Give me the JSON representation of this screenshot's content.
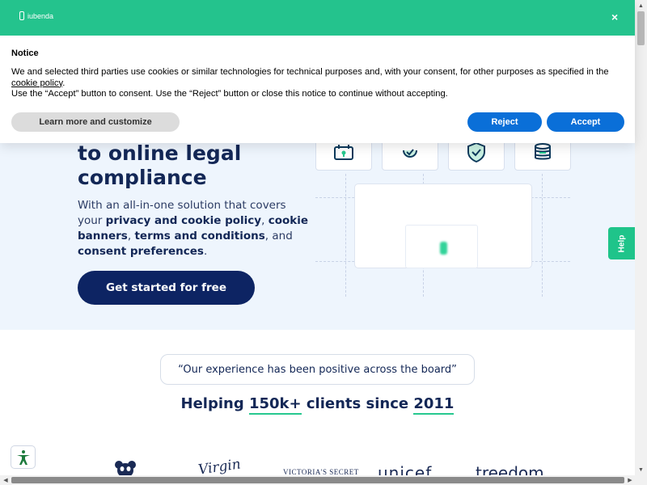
{
  "cookie_banner": {
    "brand": "iubenda",
    "close_glyph": "×",
    "title": "Notice",
    "text_before_link": "We and selected third parties use cookies or similar technologies for technical purposes and, with your consent, for other purposes as specified in the ",
    "link_text": "cookie policy",
    "text_after_link": ".",
    "text_line2": "Use the “Accept” button to consent. Use the “Reject” button or close this notice to continue without accepting.",
    "learn_more_label": "Learn more and customize",
    "reject_label": "Reject",
    "accept_label": "Accept",
    "header_color": "#24c38d",
    "button_color": "#0a6fd8"
  },
  "hero": {
    "heading_line1": "to online legal",
    "heading_line2": "compliance",
    "desc_1": "With an all-in-one solution that covers your ",
    "desc_b1": "privacy and cookie policy",
    "desc_2": ", ",
    "desc_b2": "cookie banners",
    "desc_3": ", ",
    "desc_b3": "terms and conditions",
    "desc_4": ", and ",
    "desc_b4": "consent preferences",
    "desc_5": ".",
    "cta_label": "Get started for free",
    "illustration_icons": [
      "lock-calendar-icon",
      "shield-check-icon",
      "shield-check-icon",
      "database-icon"
    ]
  },
  "help_tab": {
    "label": "Help"
  },
  "testimonial": {
    "quote": "“Our experience has been positive across the board”",
    "helping_prefix": "Helping ",
    "helping_count": "150k+",
    "helping_mid": " clients since ",
    "helping_year": "2011"
  },
  "logos": {
    "names": [
      "wwf-logo",
      "virgin-logo",
      "victorias-secret-logo",
      "unicef-logo",
      "treedom-logo"
    ],
    "virgin_text": "Virgin",
    "victoria_text": "VICTORIA'S SECRET",
    "unicef_text": "unicef",
    "treedom_text": "treedom"
  },
  "accessibility": {
    "icon": "accessibility-icon"
  }
}
